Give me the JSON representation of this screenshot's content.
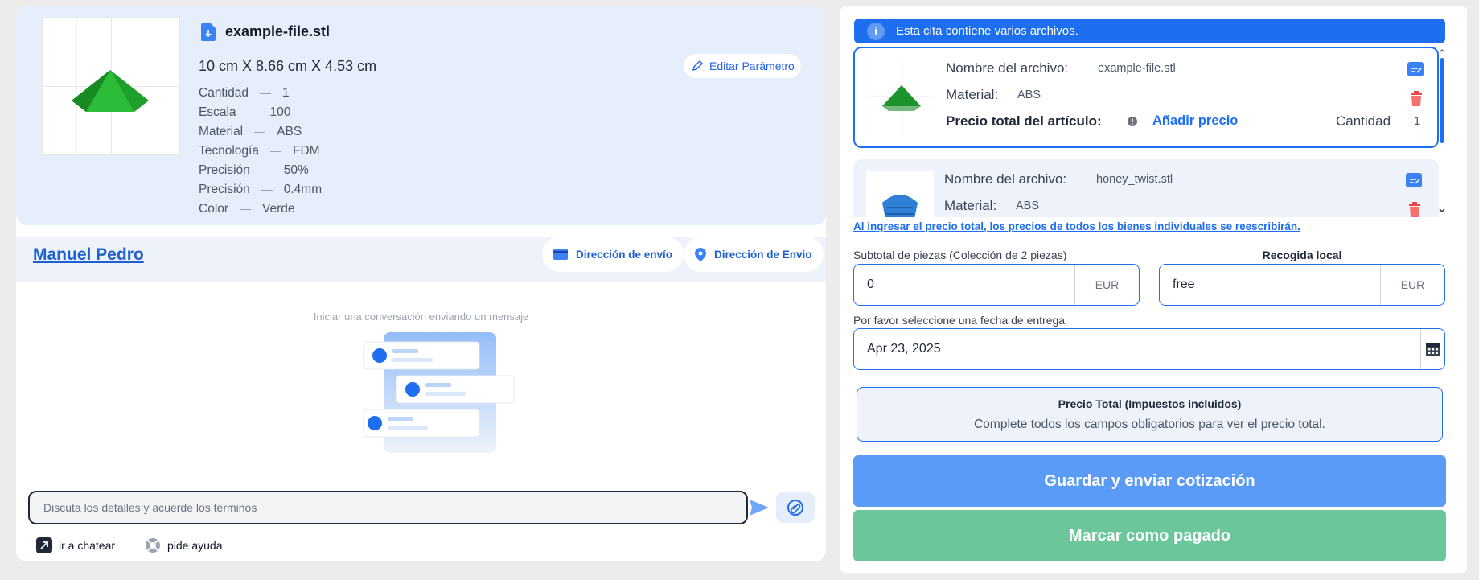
{
  "file_card": {
    "file_name": "example-file.stl",
    "dimensions": "10 cm X 8.66 cm X 4.53 cm",
    "edit_label": "Editar Parámetro",
    "specs": [
      {
        "label": "Cantidad",
        "value": "1"
      },
      {
        "label": "Escala",
        "value": "100"
      },
      {
        "label": "Material",
        "value": "ABS"
      },
      {
        "label": "Tecnología",
        "value": "FDM"
      },
      {
        "label": "Precisión",
        "value": "50%"
      },
      {
        "label": "Precisión",
        "value": "0.4mm"
      },
      {
        "label": "Color",
        "value": "Verde"
      }
    ]
  },
  "chat": {
    "user_name": "Manuel Pedro",
    "shipping_btn": "Dirección de envío",
    "billing_btn": "Dirección de Envio",
    "empty_message": "Iniciar una conversación enviando un mensaje",
    "input_placeholder": "Discuta los detalles y acuerde los términos",
    "go_chat": "ir a chatear",
    "ask_help": "pide ayuda"
  },
  "quote": {
    "info_banner": "Esta cita contiene varios archivos.",
    "files": [
      {
        "name_label": "Nombre del archivo:",
        "name": "example-file.stl",
        "material_label": "Material:",
        "material": "ABS",
        "price_label": "Precio total del artículo:",
        "add_price": "Añadir precio",
        "qty_label": "Cantidad",
        "qty": "1",
        "color": "#22a331"
      },
      {
        "name_label": "Nombre del archivo:",
        "name": "honey_twist.stl",
        "material_label": "Material:",
        "material": "ABS",
        "color": "#2f7fd6"
      }
    ],
    "overwrite_warning": "Al ingresar el precio total, los precios de todos los bienes individuales se reescribirán.",
    "subtotal_label": "Subtotal de piezas (Colección de 2 piezas)",
    "subtotal_value": "0",
    "currency": "EUR",
    "pickup_label": "Recogida local",
    "pickup_value": "free",
    "date_label": "Por favor seleccione una fecha de entrega",
    "date_value": "Apr 23, 2025",
    "total_title": "Precio Total (Impuestos incluidos)",
    "total_sub": "Complete todos los campos obligatorios para ver el precio total.",
    "save_btn": "Guardar y enviar cotización",
    "paid_btn": "Marcar como pagado"
  },
  "colors": {
    "primary": "#1e6ff0",
    "save_btn": "#5b9bf8",
    "paid_btn": "#6cc69c",
    "card_bg": "#e6eefc"
  }
}
